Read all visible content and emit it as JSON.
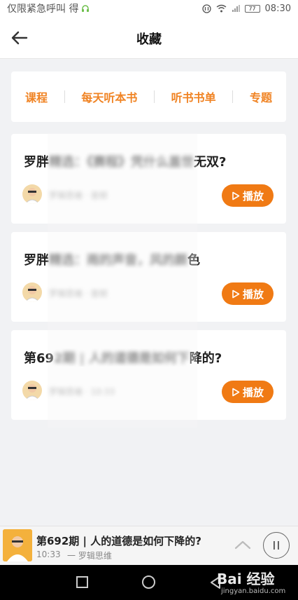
{
  "status_bar": {
    "left_text": "仅限紧急呼叫 得",
    "time": "08:30",
    "battery": "77"
  },
  "header": {
    "title": "收藏"
  },
  "tabs": [
    "课程",
    "每天听本书",
    "听书书单",
    "专题"
  ],
  "cards": [
    {
      "title_visible": "罗胖",
      "title_blurred": "精选：《赛程》凭什么盖世",
      "title_tail": "无双?",
      "meta": "罗辑思维 · 音频",
      "play_label": "播放"
    },
    {
      "title_visible": "罗胖",
      "title_blurred": "精选：雨的声音，风的颜",
      "title_tail": "色",
      "meta": "罗辑思维 · 音频",
      "play_label": "播放"
    },
    {
      "title_visible": "第69",
      "title_blurred": "2期 | 人的道德是如何下",
      "title_tail": "降的?",
      "meta": "罗辑思维 · 10:33",
      "play_label": "播放"
    }
  ],
  "player": {
    "title": "第692期 | 人的道德是如何下降的?",
    "time": "10:33",
    "author": "一 罗辑思维"
  },
  "watermark": {
    "main": "Bai 经验",
    "sub": "jingyan.baidu.com"
  },
  "colors": {
    "accent": "#f07a14",
    "tab_text": "#f08323",
    "background": "#f1f2f4"
  }
}
